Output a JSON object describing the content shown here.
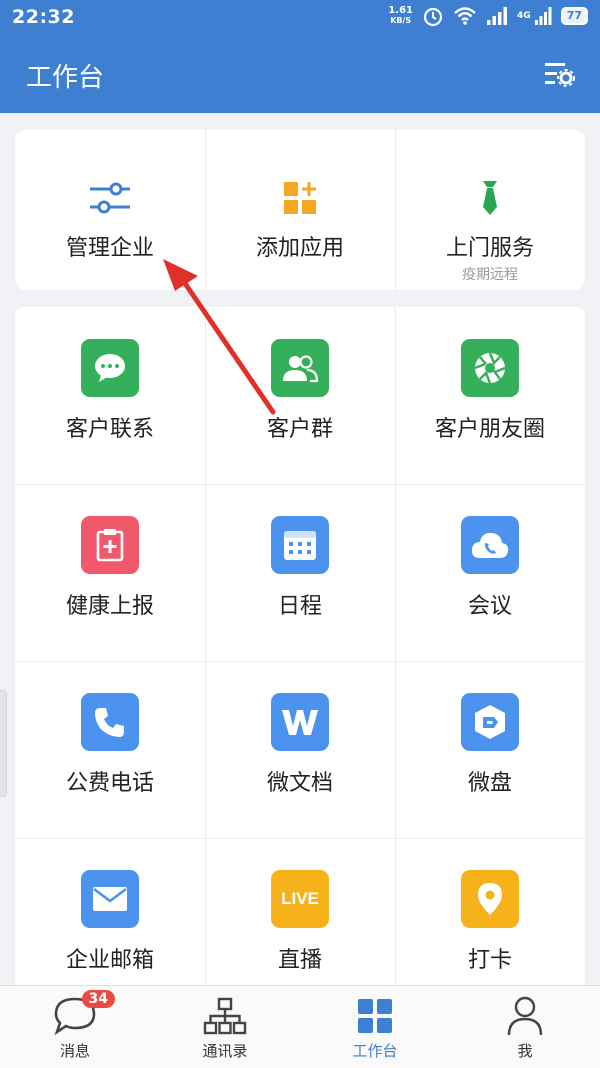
{
  "status": {
    "time": "22:32",
    "speed": "1.61",
    "speed_unit": "KB/S",
    "signal2": "4G",
    "battery": "77"
  },
  "header": {
    "title": "工作台"
  },
  "top_apps": [
    {
      "label": "管理企业",
      "sub": ""
    },
    {
      "label": "添加应用",
      "sub": ""
    },
    {
      "label": "上门服务",
      "sub": "疫期远程"
    }
  ],
  "apps": [
    {
      "label": "客户联系",
      "color": "#34b05a"
    },
    {
      "label": "客户群",
      "color": "#34b05a"
    },
    {
      "label": "客户朋友圈",
      "color": "#34b05a"
    },
    {
      "label": "健康上报",
      "color": "#f2586c"
    },
    {
      "label": "日程",
      "color": "#4c93f0"
    },
    {
      "label": "会议",
      "color": "#4c93f0"
    },
    {
      "label": "公费电话",
      "color": "#4c93f0"
    },
    {
      "label": "微文档",
      "color": "#4c93f0"
    },
    {
      "label": "微盘",
      "color": "#4c93f0"
    },
    {
      "label": "企业邮箱",
      "color": "#4c93f0"
    },
    {
      "label": "直播",
      "color": "#f6b21b",
      "badge_text": "LIVE"
    },
    {
      "label": "打卡",
      "color": "#f6b21b"
    }
  ],
  "tabs": [
    {
      "label": "消息",
      "badge": "34"
    },
    {
      "label": "通讯录"
    },
    {
      "label": "工作台"
    },
    {
      "label": "我"
    }
  ],
  "colors": {
    "header": "#3e7fd1",
    "accent": "#3e7fd1",
    "arrow": "#e0302a"
  }
}
